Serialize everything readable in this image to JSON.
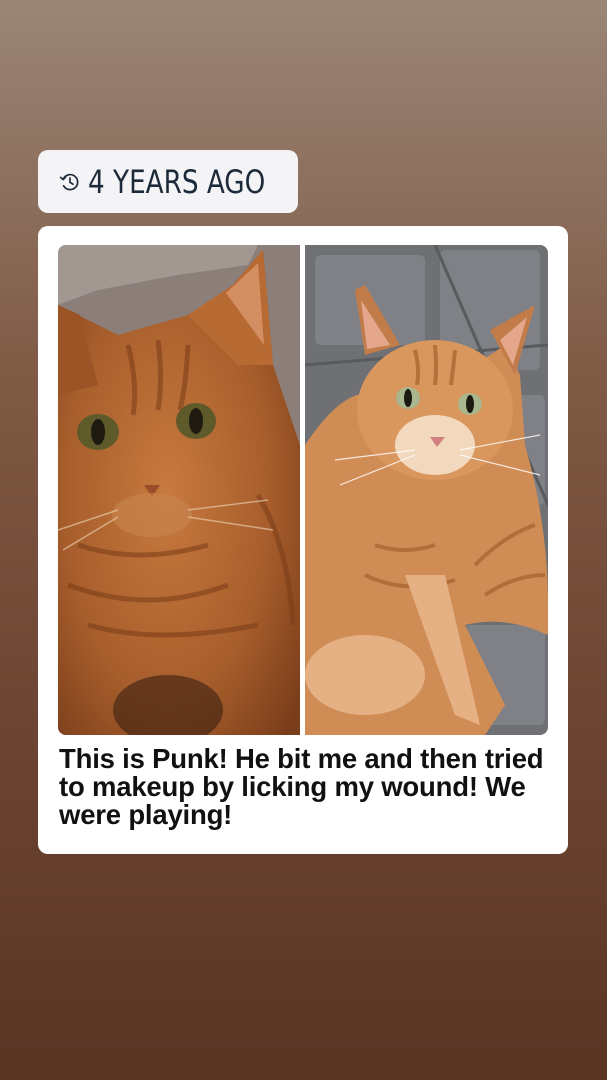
{
  "memory": {
    "label": "4 YEARS AGO",
    "icon": "clock-rewind-icon"
  },
  "post": {
    "caption": "This is Punk! He bit me and then tried to makeup by licking my wound! We were playing!"
  },
  "colors": {
    "badge_bg": "#f4f4f6",
    "badge_text": "#1d2a3a",
    "card_bg": "#ffffff",
    "caption_text": "#111111"
  }
}
